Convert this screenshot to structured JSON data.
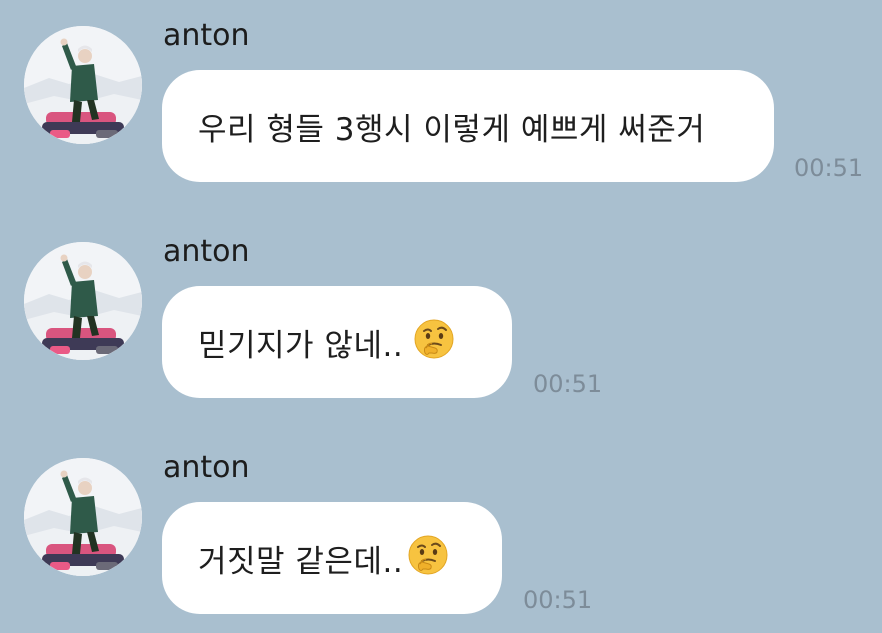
{
  "messages": [
    {
      "sender": "anton",
      "text": "우리 형들 3행시 이렇게 예쁘게 써준거",
      "emoji": "",
      "time": "00:51"
    },
    {
      "sender": "anton",
      "text": "믿기지가 않네..",
      "emoji": "thinking-face-icon",
      "time": "00:51"
    },
    {
      "sender": "anton",
      "text": "거짓말 같은데..",
      "emoji": "thinking-face-icon",
      "time": "00:51"
    }
  ],
  "colors": {
    "background": "#a9bfcf",
    "bubble": "#ffffff",
    "timestamp": "#7d8c99"
  }
}
